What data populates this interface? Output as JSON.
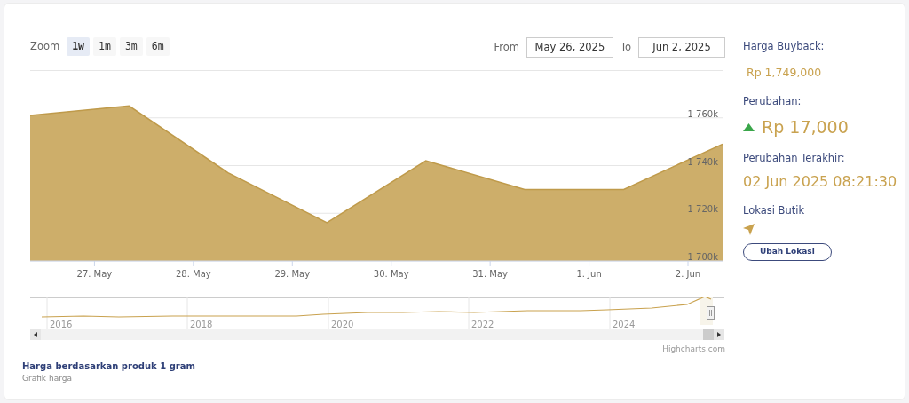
{
  "range_selector": {
    "label": "Zoom",
    "buttons": [
      {
        "label": "1w",
        "selected": true
      },
      {
        "label": "1m",
        "selected": false
      },
      {
        "label": "3m",
        "selected": false
      },
      {
        "label": "6m",
        "selected": false
      }
    ]
  },
  "date_range": {
    "from_label": "From",
    "from": "May 26, 2025",
    "to_label": "To",
    "to": "Jun 2, 2025"
  },
  "chart": {
    "chart_data": {
      "type": "area",
      "categories": [
        null,
        "27. May",
        "28. May",
        "29. May",
        "30. May",
        "31. May",
        "1. Jun",
        "2. Jun"
      ],
      "series": [
        {
          "color": "#cdae6a",
          "values": [
            1761,
            1765,
            1737,
            1716,
            1742,
            1730,
            1730,
            1749
          ]
        }
      ],
      "ylim": [
        1700,
        1780
      ],
      "grid": true,
      "yticks": [
        {
          "value": 1700,
          "label": "1 700k"
        },
        {
          "value": 1720,
          "label": "1 720k"
        },
        {
          "value": 1740,
          "label": "1 740k"
        },
        {
          "value": 1760,
          "label": "1 760k"
        }
      ]
    }
  },
  "navigator": {
    "year_labels": [
      "2016",
      "2018",
      "2020",
      "2022",
      "2024"
    ]
  },
  "credit": "Highcharts.com",
  "caption": {
    "title": "Harga berdasarkan produk 1 gram",
    "subtitle": "Grafik harga"
  },
  "info": {
    "buyback_label": "Harga Buyback:",
    "buyback_value": "Rp 1,749,000",
    "change_label": "Perubahan:",
    "change_value": "Rp 17,000",
    "last_change_label": "Perubahan Terakhir:",
    "last_change_value": "02 Jun 2025 08:21:30",
    "location_label": "Lokasi Butik",
    "location_button": "Ubah Lokasi"
  }
}
